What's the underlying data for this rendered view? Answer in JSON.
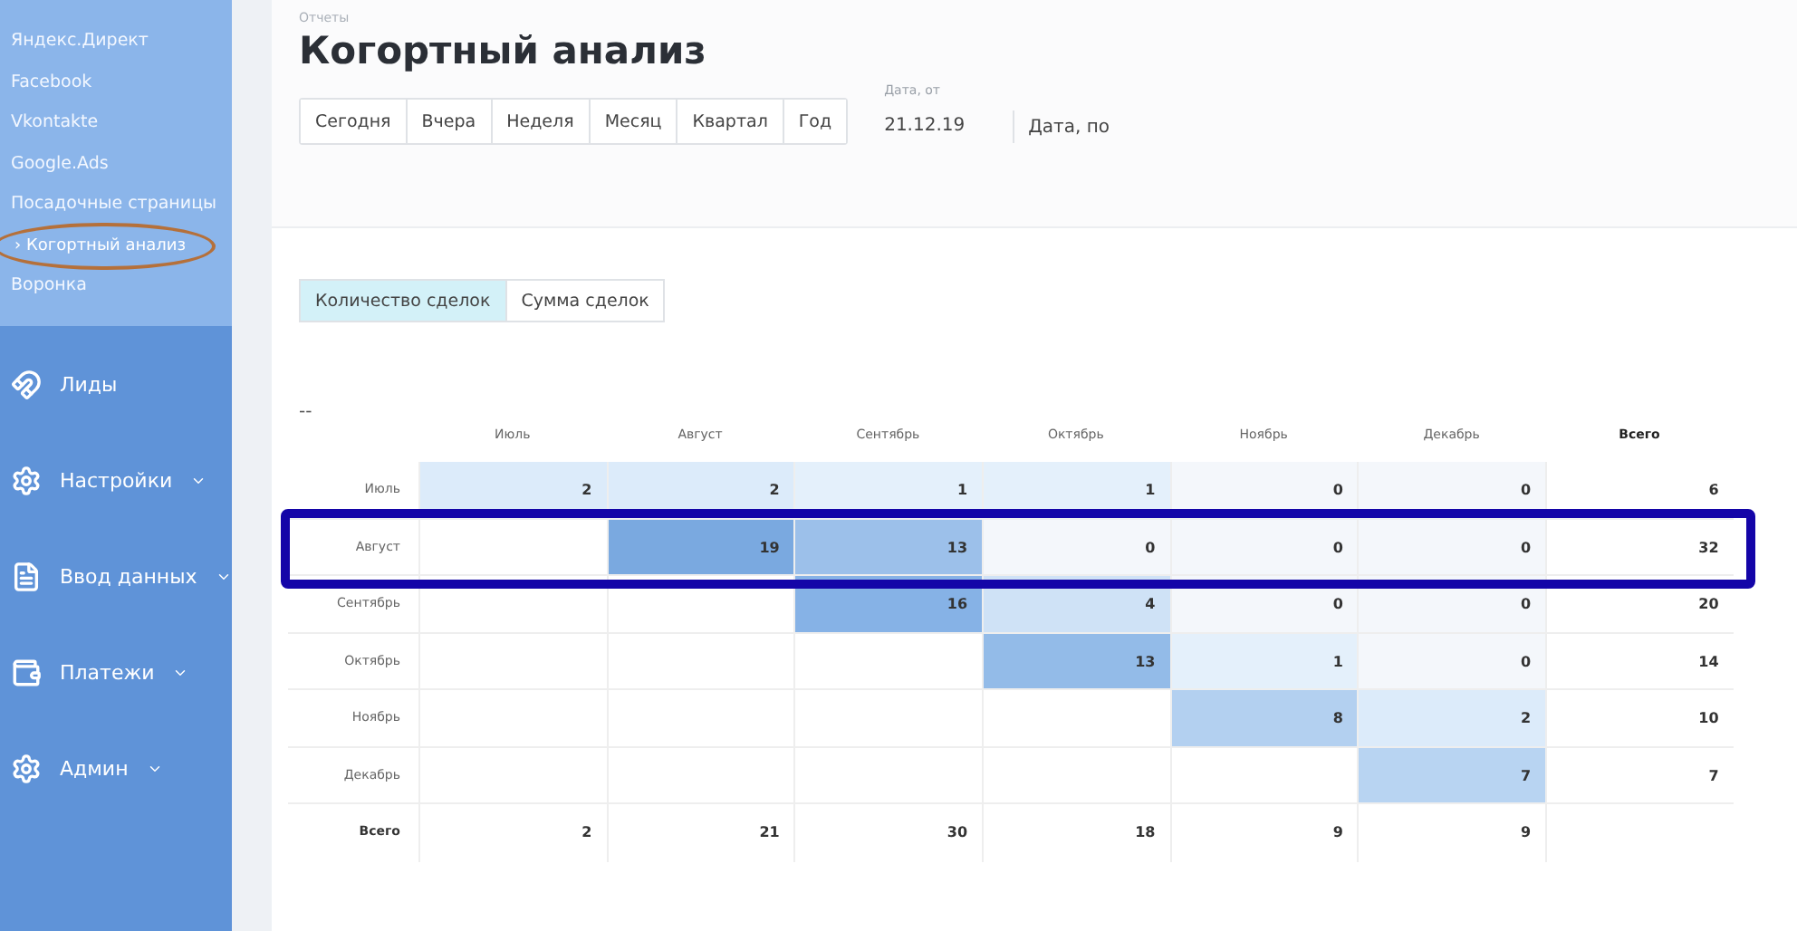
{
  "sidebar": {
    "sub_items": [
      {
        "label": "Яндекс.Директ",
        "selected": false,
        "circled": false
      },
      {
        "label": "Facebook",
        "selected": false,
        "circled": false
      },
      {
        "label": "Vkontakte",
        "selected": false,
        "circled": false
      },
      {
        "label": "Google.Ads",
        "selected": false,
        "circled": false
      },
      {
        "label": "Посадочные страницы",
        "selected": false,
        "circled": false
      },
      {
        "label": "Когортный анализ",
        "selected": true,
        "circled": true,
        "marker": "›"
      },
      {
        "label": "Воронка",
        "selected": false,
        "circled": false
      }
    ],
    "menu": [
      {
        "label": "Лиды",
        "dropdown": false
      },
      {
        "label": "Настройки",
        "dropdown": true
      },
      {
        "label": "Ввод данных",
        "dropdown": true
      },
      {
        "label": "Платежи",
        "dropdown": true
      },
      {
        "label": "Админ",
        "dropdown": true
      }
    ]
  },
  "breadcrumb": "Отчеты",
  "title": "Когортный анализ",
  "periods": [
    {
      "label": "Сегодня",
      "selected": false
    },
    {
      "label": "Вчера",
      "selected": false
    },
    {
      "label": "Неделя",
      "selected": false
    },
    {
      "label": "Месяц",
      "selected": false
    },
    {
      "label": "Квартал",
      "selected": false
    },
    {
      "label": "Год",
      "selected": false
    }
  ],
  "date_from": {
    "label": "Дата, от",
    "value": "21.12.19"
  },
  "date_to": {
    "placeholder": "Дата, по"
  },
  "metric_tabs": [
    {
      "label": "Количество сделок",
      "selected": true
    },
    {
      "label": "Сумма сделок",
      "selected": false
    }
  ],
  "table": {
    "corner": "--",
    "columns": [
      "Июль",
      "Август",
      "Сентябрь",
      "Октябрь",
      "Ноябрь",
      "Декабрь",
      "Всего"
    ],
    "rows": [
      {
        "label": "Июль",
        "highlighted": false,
        "cells": [
          {
            "value": "2",
            "color": "#dcebfa"
          },
          {
            "value": "2",
            "color": "#dcebfa"
          },
          {
            "value": "1",
            "color": "#e4f0fb"
          },
          {
            "value": "1",
            "color": "#e4f0fb"
          },
          {
            "value": "0",
            "color": "#f4f7fb"
          },
          {
            "value": "0",
            "color": "#f4f7fb"
          }
        ],
        "total": "6"
      },
      {
        "label": "Август",
        "highlighted": true,
        "cells": [
          null,
          {
            "value": "19",
            "color": "#7aa9e0"
          },
          {
            "value": "13",
            "color": "#9cc0ea"
          },
          {
            "value": "0",
            "color": "#f4f7fb"
          },
          {
            "value": "0",
            "color": "#f4f7fb"
          },
          {
            "value": "0",
            "color": "#f4f7fb"
          }
        ],
        "total": "32"
      },
      {
        "label": "Сентябрь",
        "highlighted": false,
        "cells": [
          null,
          null,
          {
            "value": "16",
            "color": "#86b2e6"
          },
          {
            "value": "4",
            "color": "#cfe2f6"
          },
          {
            "value": "0",
            "color": "#f4f7fb"
          },
          {
            "value": "0",
            "color": "#f4f7fb"
          }
        ],
        "total": "20"
      },
      {
        "label": "Октябрь",
        "highlighted": false,
        "cells": [
          null,
          null,
          null,
          {
            "value": "13",
            "color": "#93bbe8"
          },
          {
            "value": "1",
            "color": "#e4f0fb"
          },
          {
            "value": "0",
            "color": "#f4f7fb"
          }
        ],
        "total": "14"
      },
      {
        "label": "Ноябрь",
        "highlighted": false,
        "cells": [
          null,
          null,
          null,
          null,
          {
            "value": "8",
            "color": "#b3d0f0"
          },
          {
            "value": "2",
            "color": "#dcebfa"
          }
        ],
        "total": "10"
      },
      {
        "label": "Декабрь",
        "highlighted": false,
        "cells": [
          null,
          null,
          null,
          null,
          null,
          {
            "value": "7",
            "color": "#b8d4f2"
          }
        ],
        "total": "7"
      }
    ],
    "totals": {
      "label": "Всего",
      "values": [
        "2",
        "21",
        "30",
        "18",
        "9",
        "9"
      ]
    }
  }
}
